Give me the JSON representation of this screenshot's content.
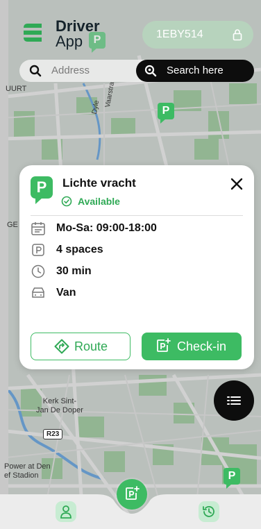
{
  "app": {
    "title_line1": "Driver",
    "title_line2": "App",
    "plate": "1EBY514"
  },
  "search": {
    "address_placeholder": "Address",
    "search_here_label": "Search here"
  },
  "map": {
    "labels": {
      "street_uurt": "UURT",
      "street_dyle": "Dyle",
      "street_vaarstraat": "Vaarstra",
      "church": "Kerk Sint-\nJan De Doper",
      "road_shield": "R23",
      "stadium": "Power at Den\nef Stadion",
      "edge_fragment": "GE"
    },
    "pin_letter": "P"
  },
  "parking_card": {
    "pin_letter": "P",
    "title": "Lichte vracht",
    "status": "Available",
    "status_color": "#2fa955",
    "details": [
      {
        "icon": "calendar-icon",
        "text": "Mo-Sa: 09:00-18:00"
      },
      {
        "icon": "parking-icon",
        "text": "4 spaces"
      },
      {
        "icon": "clock-icon",
        "text": "30 min"
      },
      {
        "icon": "van-icon",
        "text": "Van"
      }
    ],
    "route_label": "Route",
    "checkin_label": "Check-in"
  },
  "colors": {
    "brand_green": "#3dbb63",
    "dark": "#0d0d0d",
    "light_green": "#c7ecd2"
  }
}
